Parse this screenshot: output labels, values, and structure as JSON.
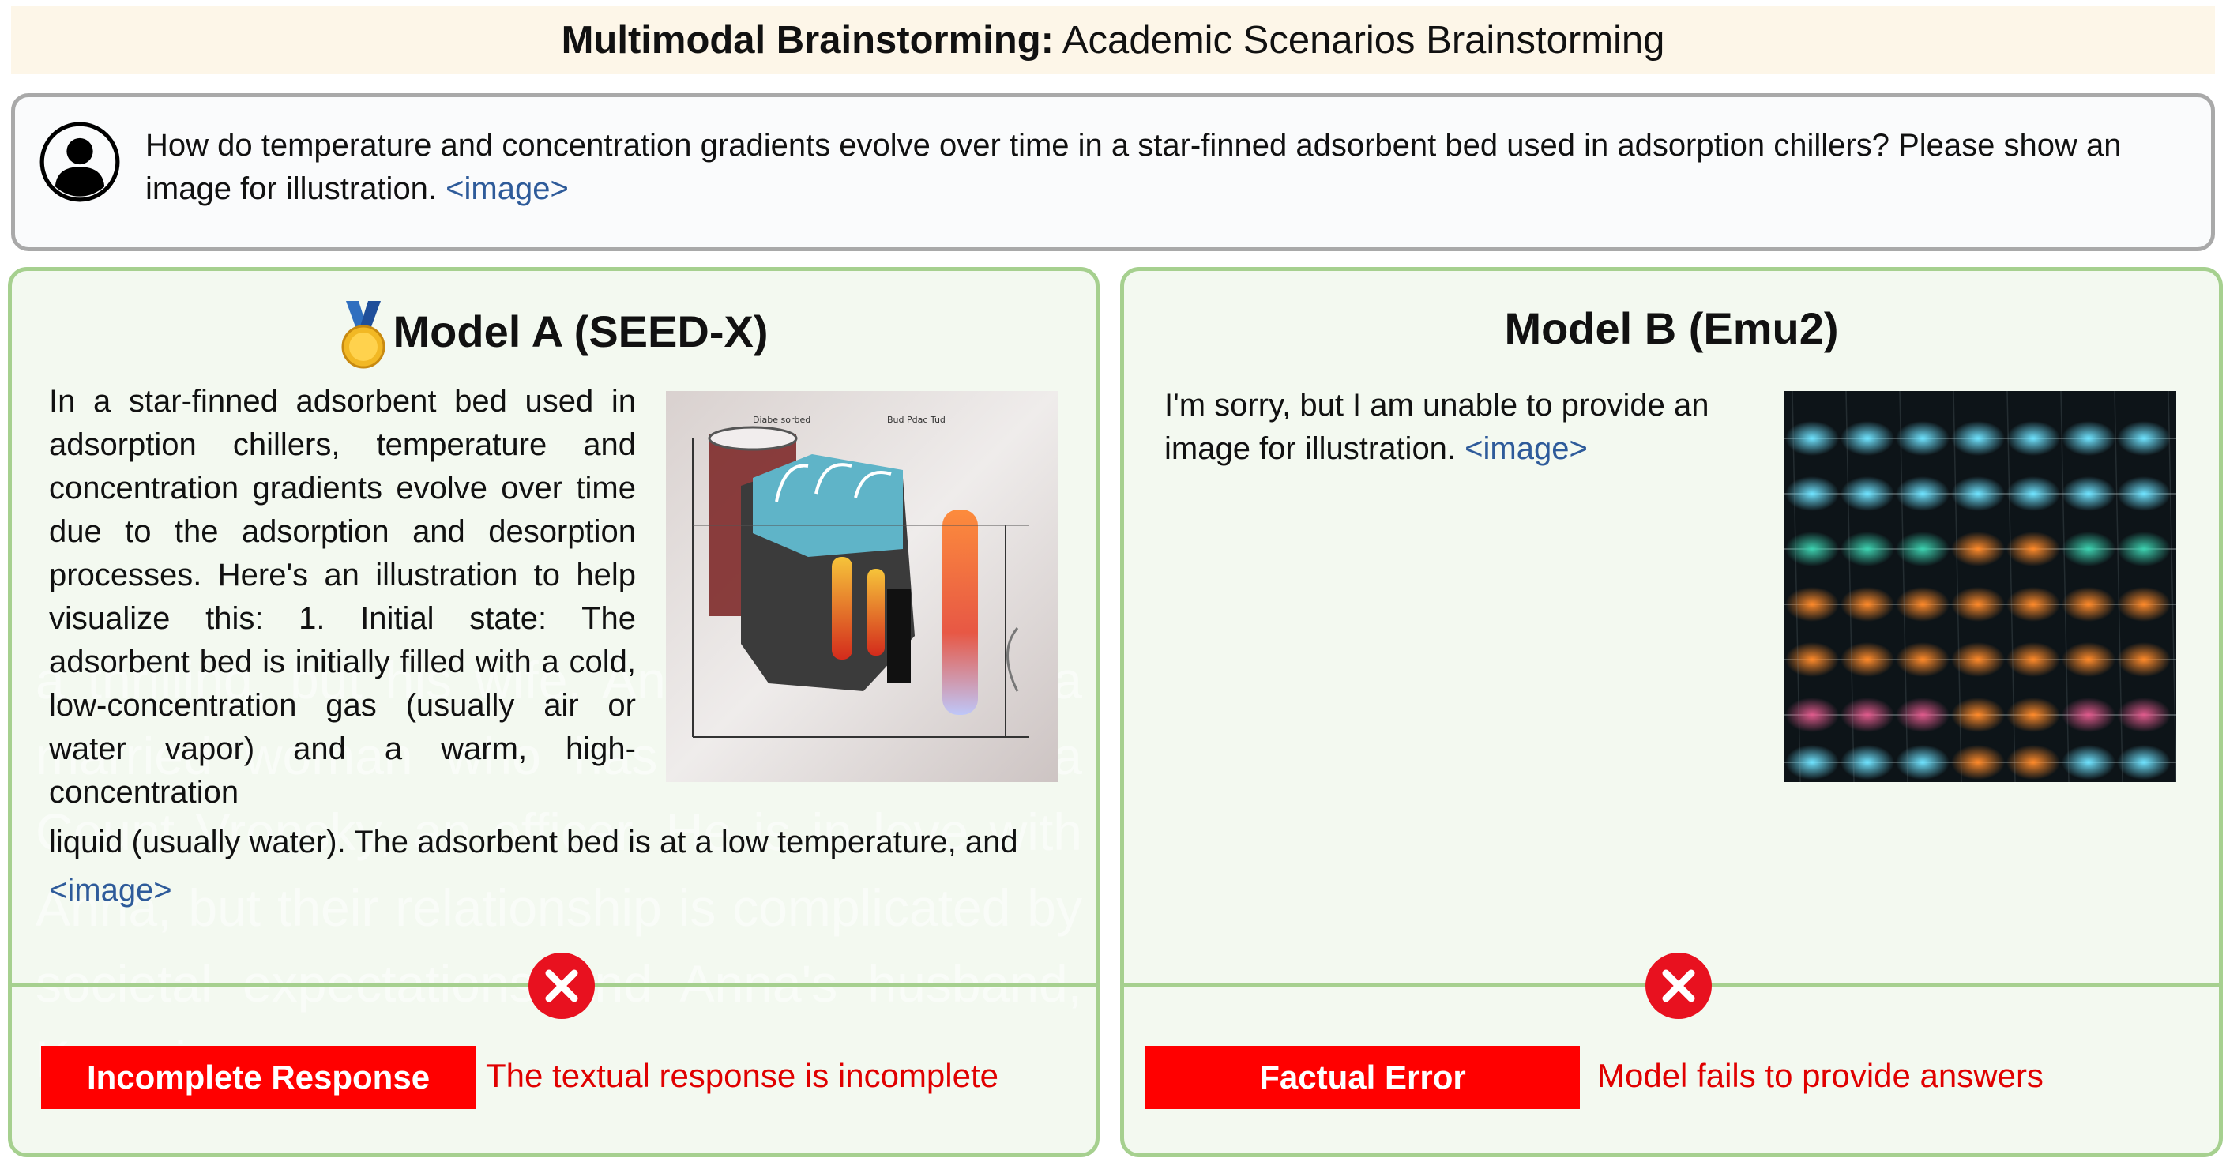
{
  "header": {
    "title_bold": "Multimodal Brainstorming:",
    "title_rest": " Academic Scenarios Brainstorming"
  },
  "question": {
    "text": "How do temperature and concentration gradients evolve over time in a star-finned adsorbent bed used in adsorption chillers? Please show an image for illustration. ",
    "image_tag": "<image>",
    "icon": "user-avatar-icon"
  },
  "model_a": {
    "title": "Model A (SEED-X)",
    "medal_icon": "gold-medal-icon",
    "response_text": "In a star-finned adsorbent bed used in adsorption chillers, temperature and concentration gradients evolve over time due to the adsorption and desorption processes. Here's an illustration to help visualize this: 1. Initial state: The adsorbent bed is initially filled with a cold, low-concentration gas (usually air or water vapor) and a warm, high-concentration",
    "response_tail": "liquid (usually water). The adsorbent bed is at a low temperature, and ",
    "image_tag": "<image>",
    "ghost_text": "a thrilling, but his wife, Anna Karenina, is a married woman who has an affair with a Count Vronsky, an officer. He is in love with Anna, but their relationship is complicated by societal expectations and Anna's husband, Karenin.",
    "error_label": "Incomplete Response",
    "error_desc": "The textual response is incomplete",
    "error_icon": "x-circle-icon"
  },
  "model_b": {
    "title": "Model B (Emu2)",
    "response_text": "I'm sorry, but I am unable to provide an image for illustration. ",
    "image_tag": "<image>",
    "error_label": "Factual Error",
    "error_desc": "Model fails to provide answers",
    "error_icon": "x-circle-icon"
  },
  "colors": {
    "panel_border": "#a6d08f",
    "panel_bg": "#f3f9f0",
    "error_red": "#ff0000",
    "tag_blue": "#2e5b9a",
    "title_bg": "#fdf6e8"
  }
}
